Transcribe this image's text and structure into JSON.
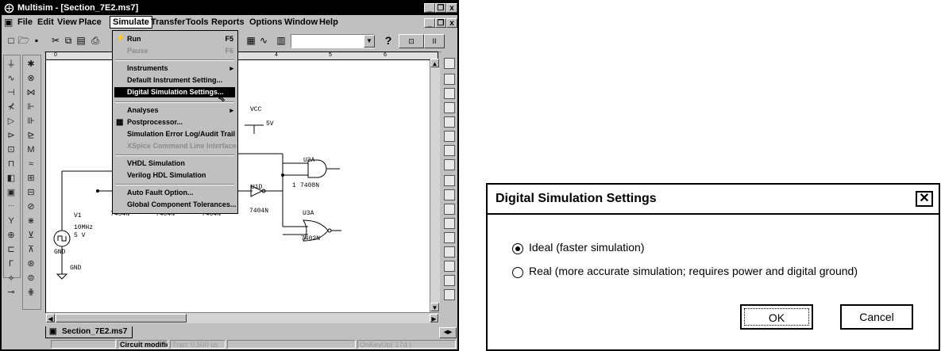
{
  "multisim": {
    "title": "Multisim - [Section_7E2.ms7]",
    "title_buttons": [
      "_",
      "❐",
      "x"
    ],
    "menu": [
      "File",
      "Edit",
      "View",
      "Place",
      "Simulate",
      "Transfer",
      "Tools",
      "Reports",
      "Options",
      "Window",
      "Help"
    ],
    "menu_active": "Simulate",
    "doc_buttons": [
      "_",
      "❐",
      "x"
    ],
    "toolbar_help": "?",
    "ruler": [
      "0",
      "4",
      "5",
      "6"
    ],
    "simulate_menu": [
      {
        "label": "Run",
        "accel": "F5",
        "state": "enabled"
      },
      {
        "label": "Pause",
        "accel": "F6",
        "state": "disabled"
      },
      {
        "label": "Instruments",
        "accel": "▸",
        "state": "enabled"
      },
      {
        "label": "Default Instrument Setting...",
        "accel": "",
        "state": "enabled"
      },
      {
        "label": "Digital Simulation Settings...",
        "accel": "",
        "state": "selected"
      },
      {
        "label": "Analyses",
        "accel": "▸",
        "state": "enabled"
      },
      {
        "label": "Postprocessor...",
        "accel": "",
        "state": "enabled"
      },
      {
        "label": "Simulation Error Log/Audit Trail",
        "accel": "",
        "state": "enabled"
      },
      {
        "label": "XSpice Command Line Interface",
        "accel": "",
        "state": "disabled"
      },
      {
        "label": "VHDL Simulation",
        "accel": "",
        "state": "enabled"
      },
      {
        "label": "Verilog HDL Simulation",
        "accel": "",
        "state": "enabled"
      },
      {
        "label": "Auto Fault Option...",
        "accel": "",
        "state": "enabled"
      },
      {
        "label": "Global Component Tolerances...",
        "accel": "",
        "state": "enabled"
      }
    ],
    "schematic": {
      "vcc": "VCC",
      "vcc_value": "5V",
      "u2a": "U2A",
      "u2a_part": "7408N",
      "u1d": "U1D",
      "u1d_part": "7404N",
      "u3a": "U3A",
      "u3a_part": "7402N",
      "v1": "V1",
      "v1_freq": "10MHz",
      "v1_volt": "5 V",
      "gnd1": "GND",
      "gnd2": "GND",
      "part_a": "7404N",
      "part_b": "7404N",
      "part_c": "7404N",
      "node1": "1"
    },
    "tab_label": "Section_7E2.ms7",
    "status": {
      "modified": "Circuit modified",
      "tran": "Tran: 0.500 us",
      "key": "OnKeyUp( 17d )"
    }
  },
  "dialog": {
    "title": "Digital Simulation Settings",
    "close": "✕",
    "options": [
      {
        "label": "Ideal (faster simulation)",
        "selected": true
      },
      {
        "label": "Real (more accurate simulation; requires power and digital ground)",
        "selected": false
      }
    ],
    "ok": "OK",
    "cancel": "Cancel"
  }
}
